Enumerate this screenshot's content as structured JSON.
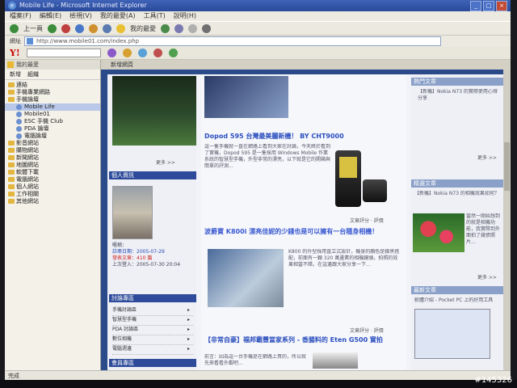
{
  "window": {
    "title": "Mobile Life - Microsoft Internet Explorer"
  },
  "menubar": [
    "檔案(F)",
    "編輯(E)",
    "檢視(V)",
    "我的最愛(A)",
    "工具(T)",
    "說明(H)"
  ],
  "toolbar": {
    "back": "上一頁",
    "favorites": "我的最愛"
  },
  "address": {
    "label": "網址",
    "url": "http://www.mobile01.com/index.php"
  },
  "yahoo": {
    "logo": "Y!"
  },
  "favorites_pane": {
    "header": "我的最愛",
    "add": "新增",
    "organize": "組織",
    "items": [
      {
        "label": "連結",
        "kind": "folder"
      },
      {
        "label": "手機專業網路",
        "kind": "folder"
      },
      {
        "label": "手機論壇",
        "kind": "folder"
      },
      {
        "label": "Mobile Life",
        "kind": "page",
        "sub": true,
        "selected": true
      },
      {
        "label": "Mobile01",
        "kind": "page",
        "sub": true
      },
      {
        "label": "ESC 手機 Club",
        "kind": "page",
        "sub": true
      },
      {
        "label": "PDA 論壇",
        "kind": "page",
        "sub": true
      },
      {
        "label": "電腦論壇",
        "kind": "page",
        "sub": true
      },
      {
        "label": "影音網站",
        "kind": "folder"
      },
      {
        "label": "購物網站",
        "kind": "folder"
      },
      {
        "label": "新聞網站",
        "kind": "folder"
      },
      {
        "label": "地圖網站",
        "kind": "folder"
      },
      {
        "label": "軟體下載",
        "kind": "folder"
      },
      {
        "label": "電腦網站",
        "kind": "folder"
      },
      {
        "label": "個人網站",
        "kind": "folder"
      },
      {
        "label": "工作相關",
        "kind": "folder"
      },
      {
        "label": "其他網站",
        "kind": "folder"
      }
    ]
  },
  "page_tab": {
    "label": "新增網頁"
  },
  "webpage": {
    "left": {
      "more1": "更多 >>",
      "section_member": "個人資訊",
      "member_lines": [
        "暱稱：",
        "註冊日期：2005-07-29",
        "發表文章：410 篇",
        "上次登入：2005-07-30 20:04"
      ],
      "section_forum": "討論專區",
      "forum_items": [
        "手機討論區",
        "智慧型手機",
        "PDA 討論區",
        "數位相機",
        "電腦週邊"
      ],
      "section_bottom": "會員專區"
    },
    "mid": {
      "headline1": "Dopod 595 台灣最美麗新機！ BY CHT9000",
      "body1": "這一隻手機就一直在網路上看到大家在討論，今天終於看到了實機，Dopod 595 是一隻採用 Windows Mobile 作業系統的智慧型手機，外型非常的漂亮，以下就是它的開箱與簡單的評測...",
      "meta1": "文章評分 · 評價",
      "headline2": "波爵寶 K800i 漂亮佳妮的少錢也是可以擁有一台隨身相機！",
      "body2": "K800 的外型採用直立式設計，機身的顏色是銀黑搭配，前面有一顆 320 萬畫素的相機鏡頭，拍照的效果相當不錯，在這邊跟大家分享一下...",
      "meta2": "文章評分 · 評價",
      "headline3": "【非常自豪】福邦霸豐當家系列 - 香腸料的 Eten G500 實拍",
      "body3": "前言：因為這一台手機是在網路上買的，所以就先來看看外觀吧...",
      "meta3": "文章評分 · 評價"
    },
    "right": {
      "section_hot": "熱門文章",
      "hot_text": "【新機】Nokia N73 的實際使用心得分享",
      "more": "更多 >>",
      "section_featured": "精選文章",
      "featured_text": "【新機】Nokia N73 的相機效果如何？",
      "featured_body": "當然一開始想到的就是相機功能，我實際到外面拍了幾張照片...",
      "section_bottom": "最新文章",
      "bottom_text": "軟體介紹 - Pocket PC 上的好用工具"
    }
  },
  "statusbar": {
    "text": "完成"
  },
  "watermark": "#145326"
}
